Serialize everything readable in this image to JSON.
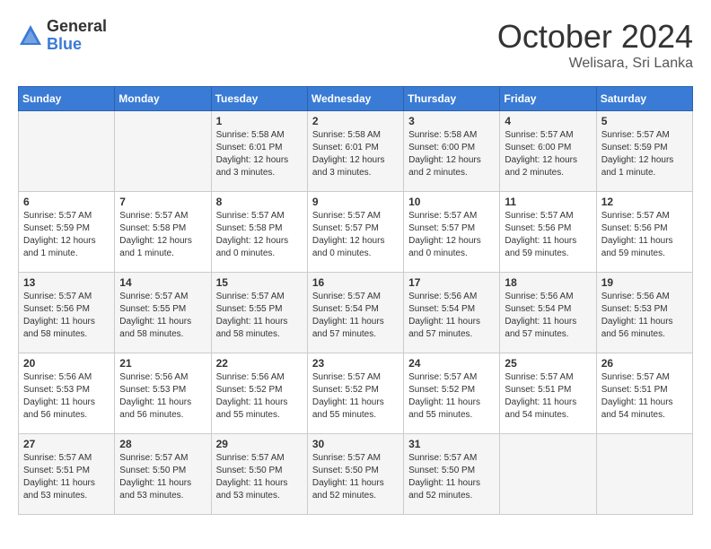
{
  "header": {
    "logo_general": "General",
    "logo_blue": "Blue",
    "month_title": "October 2024",
    "location": "Welisara, Sri Lanka"
  },
  "days_of_week": [
    "Sunday",
    "Monday",
    "Tuesday",
    "Wednesday",
    "Thursday",
    "Friday",
    "Saturday"
  ],
  "weeks": [
    [
      {
        "day": "",
        "info": ""
      },
      {
        "day": "",
        "info": ""
      },
      {
        "day": "1",
        "info": "Sunrise: 5:58 AM\nSunset: 6:01 PM\nDaylight: 12 hours and 3 minutes."
      },
      {
        "day": "2",
        "info": "Sunrise: 5:58 AM\nSunset: 6:01 PM\nDaylight: 12 hours and 3 minutes."
      },
      {
        "day": "3",
        "info": "Sunrise: 5:58 AM\nSunset: 6:00 PM\nDaylight: 12 hours and 2 minutes."
      },
      {
        "day": "4",
        "info": "Sunrise: 5:57 AM\nSunset: 6:00 PM\nDaylight: 12 hours and 2 minutes."
      },
      {
        "day": "5",
        "info": "Sunrise: 5:57 AM\nSunset: 5:59 PM\nDaylight: 12 hours and 1 minute."
      }
    ],
    [
      {
        "day": "6",
        "info": "Sunrise: 5:57 AM\nSunset: 5:59 PM\nDaylight: 12 hours and 1 minute."
      },
      {
        "day": "7",
        "info": "Sunrise: 5:57 AM\nSunset: 5:58 PM\nDaylight: 12 hours and 1 minute."
      },
      {
        "day": "8",
        "info": "Sunrise: 5:57 AM\nSunset: 5:58 PM\nDaylight: 12 hours and 0 minutes."
      },
      {
        "day": "9",
        "info": "Sunrise: 5:57 AM\nSunset: 5:57 PM\nDaylight: 12 hours and 0 minutes."
      },
      {
        "day": "10",
        "info": "Sunrise: 5:57 AM\nSunset: 5:57 PM\nDaylight: 12 hours and 0 minutes."
      },
      {
        "day": "11",
        "info": "Sunrise: 5:57 AM\nSunset: 5:56 PM\nDaylight: 11 hours and 59 minutes."
      },
      {
        "day": "12",
        "info": "Sunrise: 5:57 AM\nSunset: 5:56 PM\nDaylight: 11 hours and 59 minutes."
      }
    ],
    [
      {
        "day": "13",
        "info": "Sunrise: 5:57 AM\nSunset: 5:56 PM\nDaylight: 11 hours and 58 minutes."
      },
      {
        "day": "14",
        "info": "Sunrise: 5:57 AM\nSunset: 5:55 PM\nDaylight: 11 hours and 58 minutes."
      },
      {
        "day": "15",
        "info": "Sunrise: 5:57 AM\nSunset: 5:55 PM\nDaylight: 11 hours and 58 minutes."
      },
      {
        "day": "16",
        "info": "Sunrise: 5:57 AM\nSunset: 5:54 PM\nDaylight: 11 hours and 57 minutes."
      },
      {
        "day": "17",
        "info": "Sunrise: 5:56 AM\nSunset: 5:54 PM\nDaylight: 11 hours and 57 minutes."
      },
      {
        "day": "18",
        "info": "Sunrise: 5:56 AM\nSunset: 5:54 PM\nDaylight: 11 hours and 57 minutes."
      },
      {
        "day": "19",
        "info": "Sunrise: 5:56 AM\nSunset: 5:53 PM\nDaylight: 11 hours and 56 minutes."
      }
    ],
    [
      {
        "day": "20",
        "info": "Sunrise: 5:56 AM\nSunset: 5:53 PM\nDaylight: 11 hours and 56 minutes."
      },
      {
        "day": "21",
        "info": "Sunrise: 5:56 AM\nSunset: 5:53 PM\nDaylight: 11 hours and 56 minutes."
      },
      {
        "day": "22",
        "info": "Sunrise: 5:56 AM\nSunset: 5:52 PM\nDaylight: 11 hours and 55 minutes."
      },
      {
        "day": "23",
        "info": "Sunrise: 5:57 AM\nSunset: 5:52 PM\nDaylight: 11 hours and 55 minutes."
      },
      {
        "day": "24",
        "info": "Sunrise: 5:57 AM\nSunset: 5:52 PM\nDaylight: 11 hours and 55 minutes."
      },
      {
        "day": "25",
        "info": "Sunrise: 5:57 AM\nSunset: 5:51 PM\nDaylight: 11 hours and 54 minutes."
      },
      {
        "day": "26",
        "info": "Sunrise: 5:57 AM\nSunset: 5:51 PM\nDaylight: 11 hours and 54 minutes."
      }
    ],
    [
      {
        "day": "27",
        "info": "Sunrise: 5:57 AM\nSunset: 5:51 PM\nDaylight: 11 hours and 53 minutes."
      },
      {
        "day": "28",
        "info": "Sunrise: 5:57 AM\nSunset: 5:50 PM\nDaylight: 11 hours and 53 minutes."
      },
      {
        "day": "29",
        "info": "Sunrise: 5:57 AM\nSunset: 5:50 PM\nDaylight: 11 hours and 53 minutes."
      },
      {
        "day": "30",
        "info": "Sunrise: 5:57 AM\nSunset: 5:50 PM\nDaylight: 11 hours and 52 minutes."
      },
      {
        "day": "31",
        "info": "Sunrise: 5:57 AM\nSunset: 5:50 PM\nDaylight: 11 hours and 52 minutes."
      },
      {
        "day": "",
        "info": ""
      },
      {
        "day": "",
        "info": ""
      }
    ]
  ]
}
